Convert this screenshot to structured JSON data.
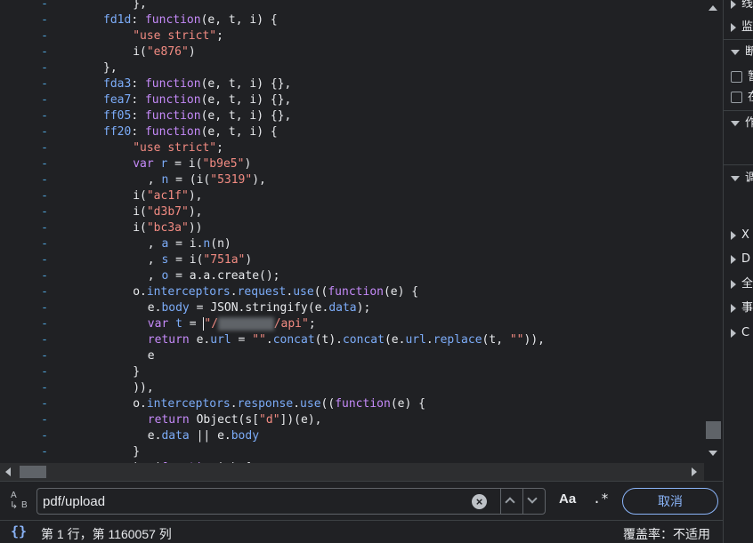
{
  "editor": {
    "gutter_marker": "-",
    "lines": [
      [
        {
          "t": "},",
          "c": "v",
          "i": 8
        }
      ],
      [
        {
          "t": "fd1d",
          "c": "kb",
          "i": 0
        },
        {
          "t": ": ",
          "c": "v"
        },
        {
          "t": "function",
          "c": "k"
        },
        {
          "t": "(e, t, i) {",
          "c": "v"
        }
      ],
      [
        {
          "t": "\"use strict\"",
          "c": "s",
          "i": 8
        },
        {
          "t": ";",
          "c": "v"
        }
      ],
      [
        {
          "t": "i(",
          "c": "v",
          "i": 8
        },
        {
          "t": "\"e876\"",
          "c": "s"
        },
        {
          "t": ")",
          "c": "v"
        }
      ],
      [
        {
          "t": "},",
          "c": "v",
          "i": 0
        }
      ],
      [
        {
          "t": "fda3",
          "c": "kb",
          "i": 0
        },
        {
          "t": ": ",
          "c": "v"
        },
        {
          "t": "function",
          "c": "k"
        },
        {
          "t": "(e, t, i) {},",
          "c": "v"
        }
      ],
      [
        {
          "t": "fea7",
          "c": "kb",
          "i": 0
        },
        {
          "t": ": ",
          "c": "v"
        },
        {
          "t": "function",
          "c": "k"
        },
        {
          "t": "(e, t, i) {},",
          "c": "v"
        }
      ],
      [
        {
          "t": "ff05",
          "c": "kb",
          "i": 0
        },
        {
          "t": ": ",
          "c": "v"
        },
        {
          "t": "function",
          "c": "k"
        },
        {
          "t": "(e, t, i) {},",
          "c": "v"
        }
      ],
      [
        {
          "t": "ff20",
          "c": "kb",
          "i": 0
        },
        {
          "t": ": ",
          "c": "v"
        },
        {
          "t": "function",
          "c": "k"
        },
        {
          "t": "(e, t, i) {",
          "c": "v"
        }
      ],
      [
        {
          "t": "\"use strict\"",
          "c": "s",
          "i": 8
        },
        {
          "t": ";",
          "c": "v"
        }
      ],
      [
        {
          "t": "var",
          "c": "k",
          "i": 8
        },
        {
          "t": " ",
          "c": "v"
        },
        {
          "t": "r",
          "c": "kb"
        },
        {
          "t": " = i(",
          "c": "v"
        },
        {
          "t": "\"b9e5\"",
          "c": "s"
        },
        {
          "t": ")",
          "c": "v"
        }
      ],
      [
        {
          "t": ", ",
          "c": "v",
          "i": 12
        },
        {
          "t": "n",
          "c": "kb"
        },
        {
          "t": " = (i(",
          "c": "v"
        },
        {
          "t": "\"5319\"",
          "c": "s"
        },
        {
          "t": "),",
          "c": "v"
        }
      ],
      [
        {
          "t": "i(",
          "c": "v",
          "i": 8
        },
        {
          "t": "\"ac1f\"",
          "c": "s"
        },
        {
          "t": "),",
          "c": "v"
        }
      ],
      [
        {
          "t": "i(",
          "c": "v",
          "i": 8
        },
        {
          "t": "\"d3b7\"",
          "c": "s"
        },
        {
          "t": "),",
          "c": "v"
        }
      ],
      [
        {
          "t": "i(",
          "c": "v",
          "i": 8
        },
        {
          "t": "\"bc3a\"",
          "c": "s"
        },
        {
          "t": "))",
          "c": "v"
        }
      ],
      [
        {
          "t": ", ",
          "c": "v",
          "i": 12
        },
        {
          "t": "a",
          "c": "kb"
        },
        {
          "t": " = i.",
          "c": "v"
        },
        {
          "t": "n",
          "c": "kb"
        },
        {
          "t": "(n)",
          "c": "v"
        }
      ],
      [
        {
          "t": ", ",
          "c": "v",
          "i": 12
        },
        {
          "t": "s",
          "c": "kb"
        },
        {
          "t": " = i(",
          "c": "v"
        },
        {
          "t": "\"751a\"",
          "c": "s"
        },
        {
          "t": ")",
          "c": "v"
        }
      ],
      [
        {
          "t": ", ",
          "c": "v",
          "i": 12
        },
        {
          "t": "o",
          "c": "kb"
        },
        {
          "t": " = a.a.create();",
          "c": "v"
        }
      ],
      [
        {
          "t": "o.",
          "c": "v",
          "i": 8
        },
        {
          "t": "interceptors",
          "c": "kb"
        },
        {
          "t": ".",
          "c": "v"
        },
        {
          "t": "request",
          "c": "kb"
        },
        {
          "t": ".",
          "c": "v"
        },
        {
          "t": "use",
          "c": "kb"
        },
        {
          "t": "((",
          "c": "v"
        },
        {
          "t": "function",
          "c": "k"
        },
        {
          "t": "(e) {",
          "c": "v"
        }
      ],
      [
        {
          "t": "e.",
          "c": "v",
          "i": 12
        },
        {
          "t": "body",
          "c": "kb"
        },
        {
          "t": " = JSON.stringify(e.",
          "c": "v"
        },
        {
          "t": "data",
          "c": "kb"
        },
        {
          "t": ");",
          "c": "v"
        }
      ],
      [
        {
          "t": "var",
          "c": "k",
          "i": 12
        },
        {
          "t": " ",
          "c": "v"
        },
        {
          "t": "t",
          "c": "kb"
        },
        {
          "t": " = ",
          "c": "v"
        },
        {
          "t": "",
          "c": "cursor"
        },
        {
          "t": "\"/",
          "c": "s"
        },
        {
          "t": "xxxxxxxx",
          "c": "blur"
        },
        {
          "t": "/api\"",
          "c": "s"
        },
        {
          "t": ";",
          "c": "v"
        }
      ],
      [
        {
          "t": "return",
          "c": "k",
          "i": 12
        },
        {
          "t": " e.",
          "c": "v"
        },
        {
          "t": "url",
          "c": "kb"
        },
        {
          "t": " = ",
          "c": "v"
        },
        {
          "t": "\"\"",
          "c": "s"
        },
        {
          "t": ".",
          "c": "v"
        },
        {
          "t": "concat",
          "c": "kb"
        },
        {
          "t": "(t).",
          "c": "v"
        },
        {
          "t": "concat",
          "c": "kb"
        },
        {
          "t": "(e.",
          "c": "v"
        },
        {
          "t": "url",
          "c": "kb"
        },
        {
          "t": ".",
          "c": "v"
        },
        {
          "t": "replace",
          "c": "kb"
        },
        {
          "t": "(t, ",
          "c": "v"
        },
        {
          "t": "\"\"",
          "c": "s"
        },
        {
          "t": ")),",
          "c": "v"
        }
      ],
      [
        {
          "t": "e",
          "c": "v",
          "i": 12
        }
      ],
      [
        {
          "t": "}",
          "c": "v",
          "i": 8
        }
      ],
      [
        {
          "t": ")),",
          "c": "v",
          "i": 8
        }
      ],
      [
        {
          "t": "o.",
          "c": "v",
          "i": 8
        },
        {
          "t": "interceptors",
          "c": "kb"
        },
        {
          "t": ".",
          "c": "v"
        },
        {
          "t": "response",
          "c": "kb"
        },
        {
          "t": ".",
          "c": "v"
        },
        {
          "t": "use",
          "c": "kb"
        },
        {
          "t": "((",
          "c": "v"
        },
        {
          "t": "function",
          "c": "k"
        },
        {
          "t": "(e) {",
          "c": "v"
        }
      ],
      [
        {
          "t": "return",
          "c": "k",
          "i": 12
        },
        {
          "t": " Object(s[",
          "c": "v"
        },
        {
          "t": "\"d\"",
          "c": "s"
        },
        {
          "t": "])(e),",
          "c": "v"
        }
      ],
      [
        {
          "t": "e.",
          "c": "v",
          "i": 12
        },
        {
          "t": "data",
          "c": "kb"
        },
        {
          "t": " || e.",
          "c": "v"
        },
        {
          "t": "body",
          "c": "kb"
        }
      ],
      [
        {
          "t": "}",
          "c": "v",
          "i": 8
        }
      ],
      [
        {
          "t": "), (",
          "c": "v",
          "i": 8
        },
        {
          "t": "function",
          "c": "k"
        },
        {
          "t": "(e) {",
          "c": "v"
        }
      ]
    ]
  },
  "side_panel": {
    "items": [
      {
        "kind": "tri-right",
        "label": "线"
      },
      {
        "kind": "tri-right",
        "label": "监"
      },
      {
        "kind": "tri-down",
        "label": "断"
      },
      {
        "kind": "check",
        "label": "暂"
      },
      {
        "kind": "check",
        "label": "在"
      },
      {
        "kind": "tri-down",
        "label": "作"
      },
      {
        "kind": "tri-down",
        "label": "调"
      },
      {
        "kind": "tri-right",
        "label": "X"
      },
      {
        "kind": "tri-right",
        "label": "D"
      },
      {
        "kind": "tri-right",
        "label": "全"
      },
      {
        "kind": "tri-right",
        "label": "事"
      },
      {
        "kind": "tri-right",
        "label": "C"
      }
    ]
  },
  "search": {
    "value": "pdf/upload",
    "match_case_label": "Aa",
    "regex_label": ".*",
    "cancel_label": "取消"
  },
  "status": {
    "format_icon": "{}",
    "cursor_position": "第 1 行，第 1160057 列",
    "coverage": "覆盖率：不适用"
  }
}
